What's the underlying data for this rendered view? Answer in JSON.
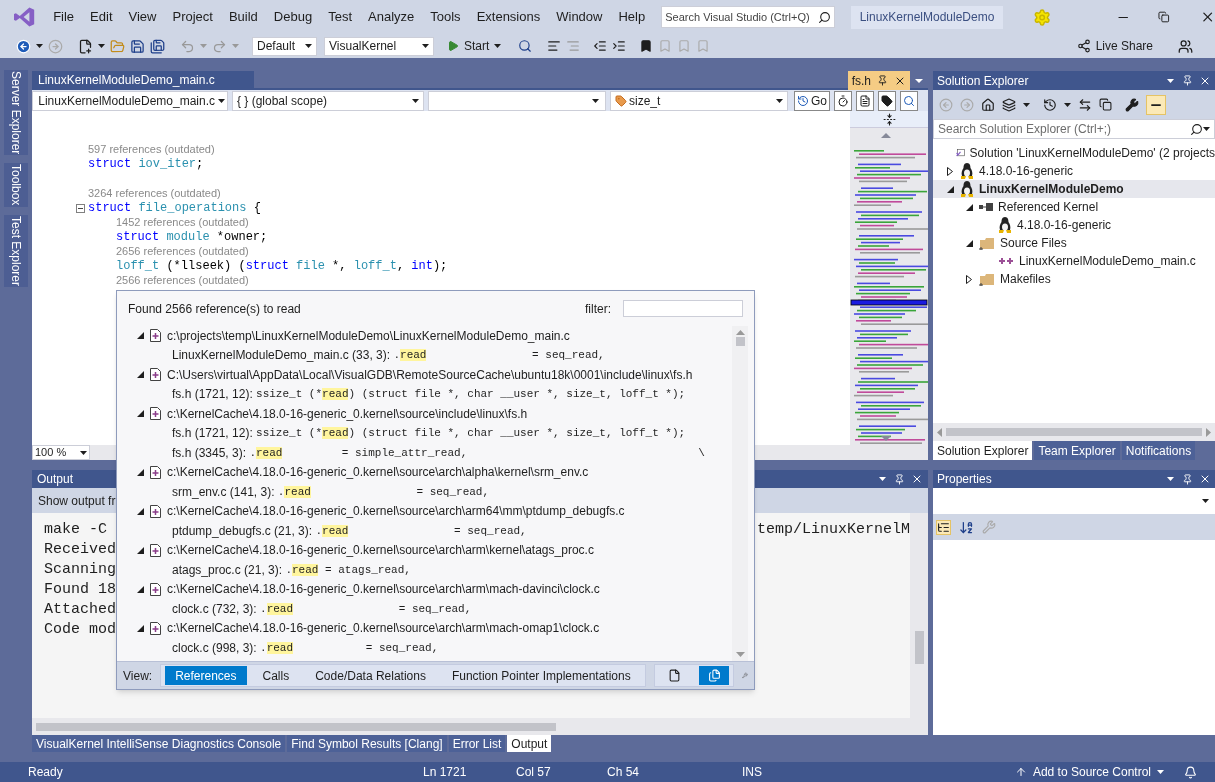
{
  "menu": {
    "items": [
      "File",
      "Edit",
      "View",
      "Project",
      "Build",
      "Debug",
      "Test",
      "Analyze",
      "Tools",
      "Extensions",
      "Window",
      "Help"
    ],
    "search": {
      "placeholder": "Search Visual Studio (Ctrl+Q)"
    },
    "solution_name": "LinuxKernelModuleDemo"
  },
  "toolbar": {
    "configuration": "Default",
    "platform": "VisualKernel",
    "start": "Start",
    "live_share": "Live Share"
  },
  "side_tabs": [
    "Server Explorer",
    "Toolbox",
    "Test Explorer"
  ],
  "editor": {
    "tabs": [
      {
        "label": "LinuxKernelModuleDemo_main.c",
        "kind": "document"
      },
      {
        "label": "fs.h",
        "kind": "preview"
      }
    ],
    "nav": {
      "file": "LinuxKernelModuleDemo_main.c",
      "scope": "{ } (global scope)",
      "member": "size_t",
      "go": "Go"
    },
    "blocks": [
      {
        "lens": "597 references (outdated)",
        "tokens": [
          {
            "text": "struct ",
            "kind": "keyword"
          },
          {
            "text": "iov_iter",
            "kind": "type"
          },
          {
            "text": ";"
          }
        ]
      },
      {
        "lens": "3264 references (outdated)",
        "expanded": true,
        "tokens": [
          {
            "text": "struct ",
            "kind": "keyword"
          },
          {
            "text": "file_operations",
            "kind": "type"
          },
          {
            "text": " {"
          }
        ],
        "children": [
          {
            "lens": "1452 references (outdated)",
            "tokens": [
              {
                "text": "struct ",
                "kind": "keyword"
              },
              {
                "text": "module",
                "kind": "type"
              },
              {
                "text": " *owner;"
              }
            ]
          },
          {
            "lens": "2656 references (outdated)",
            "tokens": [
              {
                "text": "loff_t",
                "kind": "type"
              },
              {
                "text": " (*llseek) ("
              },
              {
                "text": "struct ",
                "kind": "keyword"
              },
              {
                "text": "file",
                "kind": "type"
              },
              {
                "text": " *, "
              },
              {
                "text": "loff_t",
                "kind": "type"
              },
              {
                "text": ", "
              },
              {
                "text": "int",
                "kind": "keyword"
              },
              {
                "text": ");"
              }
            ]
          },
          {
            "lens": "2566 references (outdated)"
          }
        ]
      }
    ],
    "zoom": "100 %"
  },
  "find_references": {
    "summary": "Found 2566 reference(s) to read",
    "filter_label": "filter:",
    "groups": [
      {
        "path": "c:\\projects\\temp\\LinuxKernelModuleDemo\\LinuxKernelModuleDemo_main.c",
        "expanded": true,
        "refs": [
          {
            "location": "LinuxKernelModuleDemo_main.c (33, 3):",
            "before": ".",
            "match": "read",
            "after": "                = seq_read,"
          }
        ]
      },
      {
        "path": "C:\\Users\\virtual\\AppData\\Local\\VisualGDB\\RemoteSourceCache\\ubuntu18k\\0001\\include\\linux\\fs.h",
        "expanded": true,
        "refs": [
          {
            "location": "fs.h (1721, 12):",
            "before": "ssize_t (*",
            "match": "read",
            "after": ") (struct file *, char __user *, size_t, loff_t *);"
          }
        ]
      },
      {
        "path": "c:\\KernelCache\\4.18.0-16-generic_0.kernel\\source\\include\\linux\\fs.h",
        "expanded": true,
        "refs": [
          {
            "location": "fs.h (1721, 12):",
            "before": "ssize_t (*",
            "match": "read",
            "after": ") (struct file *, char __user *, size_t, loff_t *);"
          },
          {
            "location": "fs.h (3345, 3):",
            "before": ".",
            "match": "read",
            "after": "         = simple_attr_read,                                   \\"
          }
        ]
      },
      {
        "path": "c:\\KernelCache\\4.18.0-16-generic_0.kernel\\source\\arch\\alpha\\kernel\\srm_env.c",
        "expanded": true,
        "refs": [
          {
            "location": "srm_env.c (141, 3):",
            "before": ".",
            "match": "read",
            "after": "                = seq_read,"
          }
        ]
      },
      {
        "path": "c:\\KernelCache\\4.18.0-16-generic_0.kernel\\source\\arch\\arm64\\mm\\ptdump_debugfs.c",
        "expanded": true,
        "refs": [
          {
            "location": "ptdump_debugfs.c (21, 3):",
            "before": ".",
            "match": "read",
            "after": "                = seq_read,"
          }
        ]
      },
      {
        "path": "c:\\KernelCache\\4.18.0-16-generic_0.kernel\\source\\arch\\arm\\kernel\\atags_proc.c",
        "expanded": true,
        "refs": [
          {
            "location": "atags_proc.c (21, 3):",
            "before": ".",
            "match": "read",
            "after": " = atags_read,"
          }
        ]
      },
      {
        "path": "c:\\KernelCache\\4.18.0-16-generic_0.kernel\\source\\arch\\arm\\mach-davinci\\clock.c",
        "expanded": true,
        "refs": [
          {
            "location": "clock.c (732, 3):",
            "before": ".",
            "match": "read",
            "after": "                = seq_read,"
          }
        ]
      },
      {
        "path": "c:\\KernelCache\\4.18.0-16-generic_0.kernel\\source\\arch\\arm\\mach-omap1\\clock.c",
        "expanded": true,
        "refs": [
          {
            "location": "clock.c (998, 3):",
            "before": ".",
            "match": "read",
            "after": "           = seq_read,"
          }
        ]
      }
    ],
    "view_label": "View:",
    "views": [
      {
        "label": "References",
        "selected": true
      },
      {
        "label": "Calls",
        "selected": false
      },
      {
        "label": "Code/Data Relations",
        "selected": false
      },
      {
        "label": "Function Pointer Implementations",
        "selected": false
      }
    ],
    "modes": [
      {
        "kind": "single",
        "selected": false
      },
      {
        "kind": "multiple",
        "selected": true
      }
    ]
  },
  "output": {
    "title": "Output",
    "show_output_from": "Show output fr",
    "lines": [
      {
        "start": "make -C",
        "end": "temp/LinuxKernelM"
      },
      {
        "start": "Received"
      },
      {
        "start": "Scanning"
      },
      {
        "start": "Found 18"
      },
      {
        "start": "Attached"
      },
      {
        "start": "Code mod"
      }
    ],
    "tabs": [
      {
        "label": "VisualKernel IntelliSense Diagnostics Console",
        "selected": false
      },
      {
        "label": "Find Symbol Results [Clang]",
        "selected": false
      },
      {
        "label": "Error List",
        "selected": false
      },
      {
        "label": "Output",
        "selected": true
      }
    ]
  },
  "solution_explorer": {
    "title": "Solution Explorer",
    "search": {
      "placeholder": "Search Solution Explorer (Ctrl+;)"
    },
    "tree": [
      {
        "label": "Solution 'LinuxKernelModuleDemo' (2 projects",
        "kind": "solution",
        "selected": false
      },
      {
        "label": "4.18.0-16-generic",
        "kind": "project",
        "startup": false,
        "expanded": false,
        "selected": false
      },
      {
        "label": "LinuxKernelModuleDemo",
        "kind": "project",
        "startup": true,
        "expanded": true,
        "selected": true,
        "children": [
          {
            "label": "Referenced Kernel",
            "kind": "reference",
            "expanded": true,
            "selected": false,
            "children": [
              {
                "label": "4.18.0-16-generic",
                "kind": "kernel",
                "selected": false
              }
            ]
          },
          {
            "label": "Source Files",
            "kind": "folder",
            "expanded": true,
            "selected": false,
            "children": [
              {
                "label": "LinuxKernelModuleDemo_main.c",
                "kind": "file",
                "selected": false
              }
            ]
          },
          {
            "label": "Makefiles",
            "kind": "folder",
            "expanded": false,
            "selected": false
          }
        ]
      }
    ],
    "tabs": [
      {
        "label": "Solution Explorer",
        "selected": true
      },
      {
        "label": "Team Explorer",
        "selected": false
      },
      {
        "label": "Notifications",
        "selected": false
      }
    ]
  },
  "properties": {
    "title": "Properties"
  },
  "status_bar": {
    "message": "Ready",
    "line": "Ln 1721",
    "column": "Col 57",
    "char": "Ch 54",
    "mode": "INS",
    "source_control": "Add to Source Control"
  }
}
